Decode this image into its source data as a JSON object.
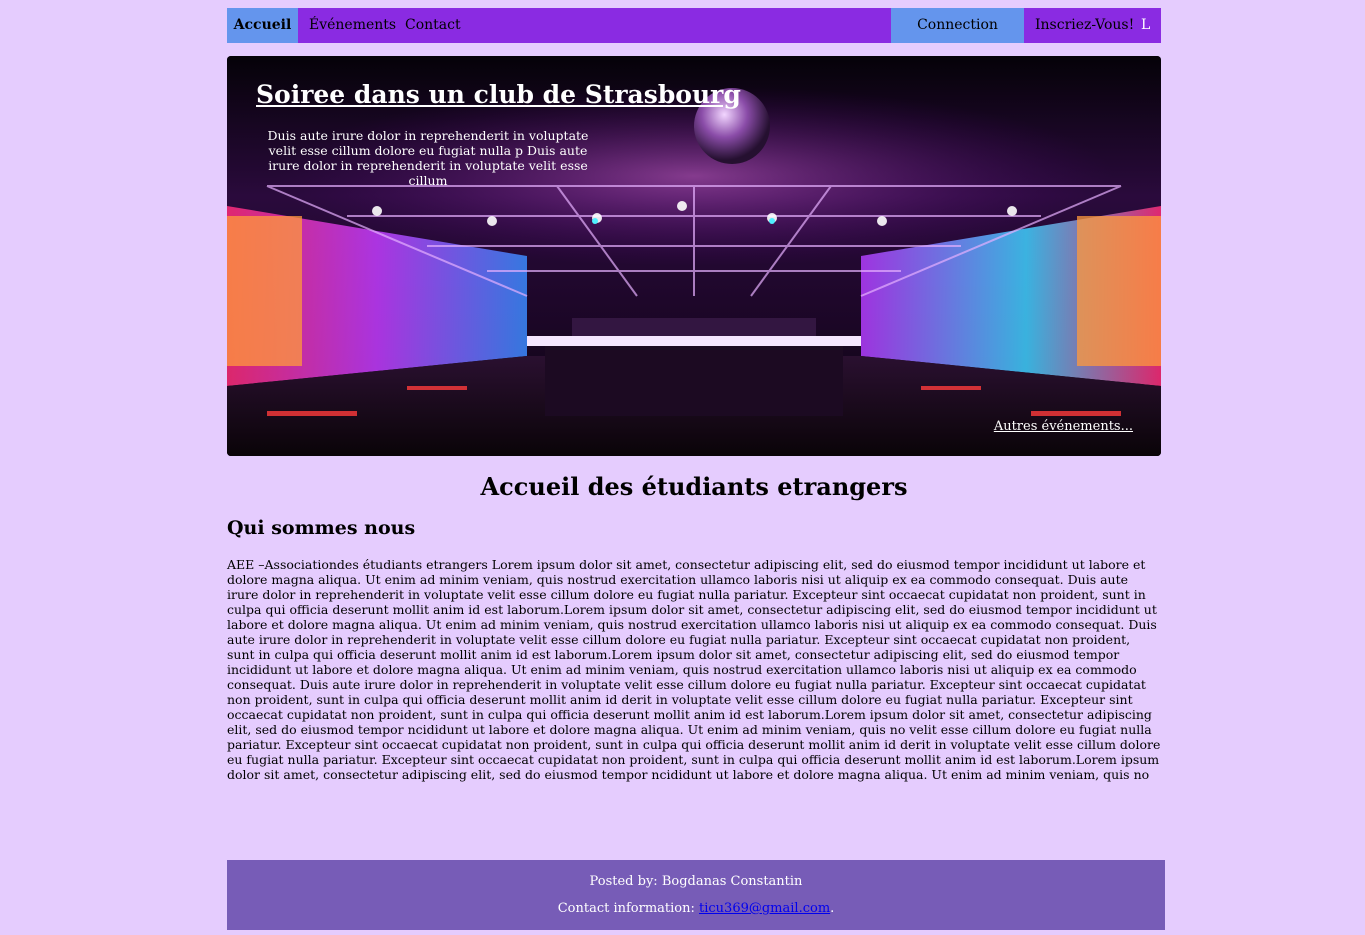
{
  "nav": {
    "home": "Accueil",
    "events": "Événements",
    "contact": "Contact",
    "login": "Connection",
    "signup": "Inscriez-Vous!",
    "extra": "L"
  },
  "hero": {
    "title": "Soiree dans un club de Strasbourg",
    "description": "Duis aute irure dolor in reprehenderit in voluptate velit esse cillum dolore eu fugiat nulla p Duis aute irure dolor in reprehenderit in voluptate velit esse cillum",
    "more_link": "Autres événements..."
  },
  "main": {
    "title": "Accueil des étudiants etrangers",
    "section_title": "Qui sommes nous",
    "section_text": "AEE –Associationdes étudiants etrangers Lorem ipsum dolor sit amet, consectetur adipiscing elit, sed do eiusmod tempor incididunt ut labore et dolore magna aliqua. Ut enim ad minim veniam, quis nostrud exercitation ullamco laboris nisi ut aliquip ex ea commodo consequat. Duis aute irure dolor in reprehenderit in voluptate velit esse cillum dolore eu fugiat nulla pariatur. Excepteur sint occaecat cupidatat non proident, sunt in culpa qui officia deserunt mollit anim id est laborum.Lorem ipsum dolor sit amet, consectetur adipiscing elit, sed do eiusmod tempor incididunt ut labore et dolore magna aliqua. Ut enim ad minim veniam, quis nostrud exercitation ullamco laboris nisi ut aliquip ex ea commodo consequat. Duis aute irure dolor in reprehenderit in voluptate velit esse cillum dolore eu fugiat nulla pariatur. Excepteur sint occaecat cupidatat non proident, sunt in culpa qui officia deserunt mollit anim id est laborum.Lorem ipsum dolor sit amet, consectetur adipiscing elit, sed do eiusmod tempor incididunt ut labore et dolore magna aliqua. Ut enim ad minim veniam, quis nostrud exercitation ullamco laboris nisi ut aliquip ex ea commodo consequat. Duis aute irure dolor in reprehenderit in voluptate velit esse cillum dolore eu fugiat nulla pariatur. Excepteur sint occaecat cupidatat non proident, sunt in culpa qui officia deserunt mollit anim id derit in voluptate velit esse cillum dolore eu fugiat nulla pariatur. Excepteur sint occaecat cupidatat non proident, sunt in culpa qui officia deserunt mollit anim id est laborum.Lorem ipsum dolor sit amet, consectetur adipiscing elit, sed do eiusmod tempor ncididunt ut labore et dolore magna aliqua. Ut enim ad minim veniam, quis no velit esse cillum dolore eu fugiat nulla pariatur. Excepteur sint occaecat cupidatat non proident, sunt in culpa qui officia deserunt mollit anim id derit in voluptate velit esse cillum dolore eu fugiat nulla pariatur. Excepteur sint occaecat cupidatat non proident, sunt in culpa qui officia deserunt mollit anim id est laborum.Lorem ipsum dolor sit amet, consectetur adipiscing elit, sed do eiusmod tempor ncididunt ut labore et dolore magna aliqua. Ut enim ad minim veniam, quis no"
  },
  "footer": {
    "posted_by": "Posted by: Bogdanas Constantin",
    "contact_label": "Contact information: ",
    "email": "ticu369@gmail.com",
    "email_suffix": "."
  },
  "colors": {
    "page_background": "#e5ccfe",
    "navbar": "#8a2be2",
    "nav_active": "#6495ed",
    "footer": "#775cb7",
    "link": "#0000ee"
  }
}
